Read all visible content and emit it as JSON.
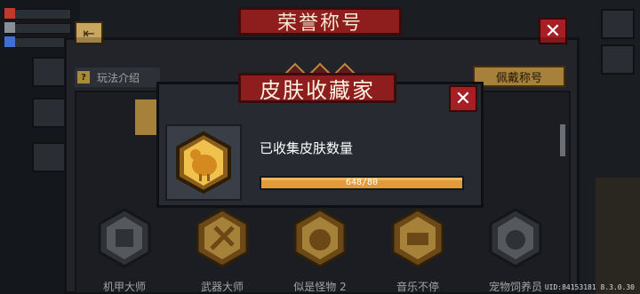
{
  "main": {
    "title": "荣誉称号",
    "intro_label": "玩法介绍",
    "wear_label": "佩戴称号"
  },
  "badges": [
    {
      "label": "机甲大师",
      "icon": "mech-icon",
      "color": "#6d7178"
    },
    {
      "label": "武器大师",
      "icon": "weapon-icon",
      "color": "#d4a64a"
    },
    {
      "label": "似是怪物 2",
      "icon": "monster-icon",
      "color": "#d4a64a"
    },
    {
      "label": "音乐不停",
      "icon": "music-icon",
      "color": "#d4a64a"
    },
    {
      "label": "宠物饲养员",
      "icon": "pet-icon",
      "color": "#6d7178"
    }
  ],
  "dialog": {
    "title": "皮肤收藏家",
    "label": "已收集皮肤数量",
    "progress_text": "648/80",
    "progress_fraction": 1.0,
    "icon": "chicken-skin-icon"
  },
  "footer": {
    "uid": "UID:84153181 8.3.0.30"
  },
  "colors": {
    "accent_red": "#8e1d1d",
    "gold": "#d4a64a",
    "progress": "#e39a3a"
  }
}
